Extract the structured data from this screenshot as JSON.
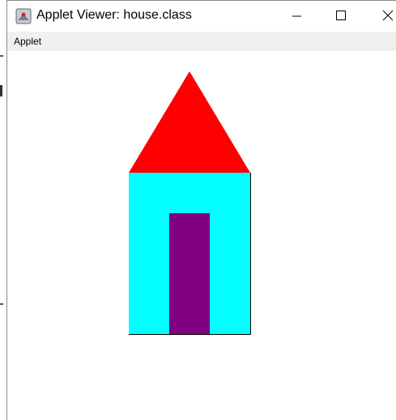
{
  "window": {
    "title": "Applet Viewer: house.class",
    "app_icon": "java-applet-icon"
  },
  "controls": {
    "minimize": "minimize-icon",
    "maximize": "maximize-icon",
    "close": "close-icon"
  },
  "menubar": {
    "items": [
      {
        "label": "Applet"
      }
    ]
  },
  "drawing": {
    "roof_color": "#ff0000",
    "wall_color": "#00ffff",
    "door_color": "#800080",
    "outline_color": "#000000"
  }
}
